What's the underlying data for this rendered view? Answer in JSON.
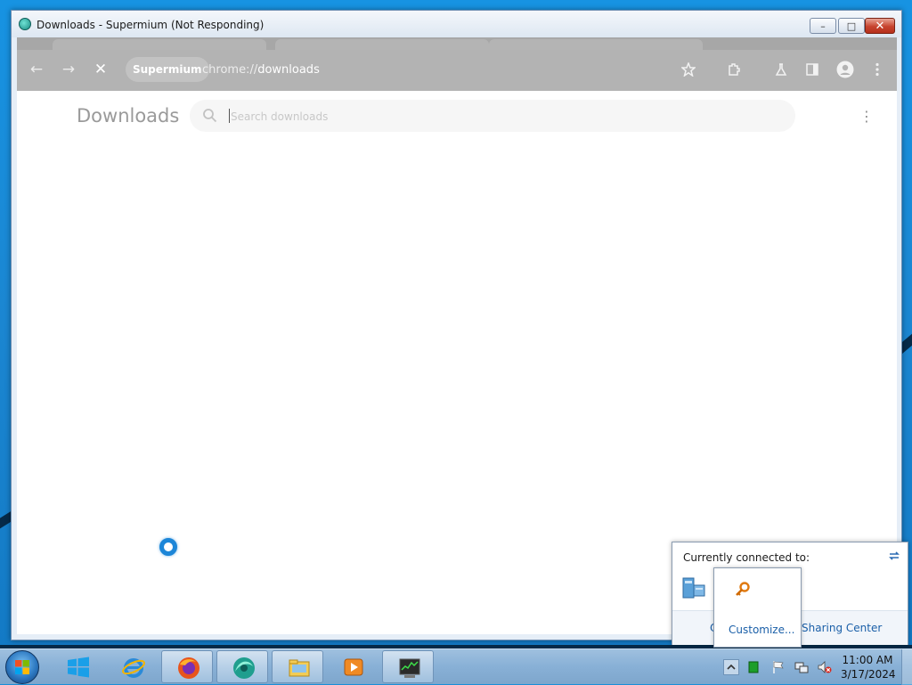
{
  "window": {
    "title": "Downloads - Supermium (Not Responding)",
    "controls": {
      "minimize": "–",
      "maximize": "□",
      "close": "✕"
    }
  },
  "toolbar": {
    "back_icon": "←",
    "forward_icon": "→",
    "stop_icon": "✕",
    "origin_chip": "Supermium",
    "url_scheme": "chrome://",
    "url_path": "downloads",
    "icons": [
      "star-icon",
      "extensions-icon",
      "labs-icon",
      "side-panel-icon",
      "profile-icon",
      "menu-icon"
    ]
  },
  "page": {
    "heading": "Downloads",
    "search_placeholder": "Search downloads",
    "menu_icon": "⋮"
  },
  "network_flyout": {
    "heading": "Currently connected to:",
    "footer_left": "C",
    "center_link": "Sharing Center"
  },
  "customize_popup": {
    "link": "Customize..."
  },
  "taskbar": {
    "apps": [
      "windows-tiles-icon",
      "internet-explorer-icon",
      "firefox-icon",
      "supermium-icon",
      "file-explorer-icon",
      "media-player-icon",
      "task-manager-icon"
    ],
    "clock_time": "11:00 AM",
    "clock_date": "3/17/2024"
  },
  "colors": {
    "desktop": "#1793e2",
    "toolbar_dimmed": "#b3b3b3",
    "link": "#1a5fa8",
    "spinner": "#1c86d8"
  }
}
